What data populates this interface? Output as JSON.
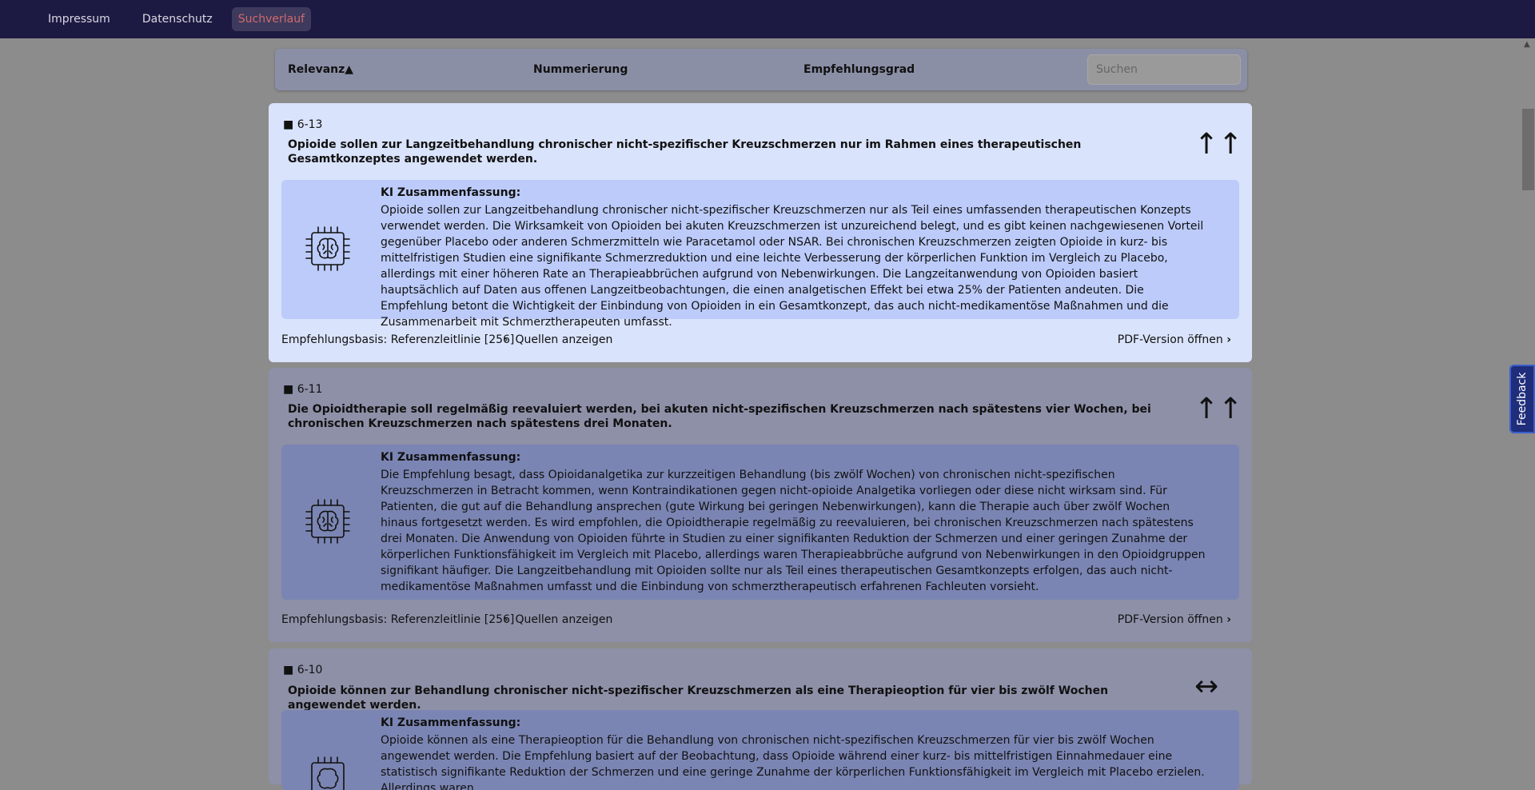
{
  "nav": {
    "links": [
      "Impressum",
      "Datenschutz",
      "Suchverlauf"
    ],
    "active_link": "Suchverlauf"
  },
  "filterbar": {
    "relevance": "Relevanz▲",
    "numbering": "Nummerierung",
    "grade": "Empfehlungsgrad",
    "search_placeholder": "Suchen"
  },
  "summary_label": "KI Zusammenfassung:",
  "footer": {
    "basis": "Empfehlungsbasis: Referenzleitlinie [256]",
    "sources": "Quellen anzeigen",
    "pdf": "PDF-Version öffnen"
  },
  "cards": [
    {
      "number": "6-13",
      "title": "Opioide sollen zur Langzeitbehandlung chronischer nicht-spezifischer Kreuzschmerzen nur im Rahmen eines therapeutischen Gesamtkonzeptes angewendet werden.",
      "grade_symbol": "↑↑",
      "summary": "Opioide sollen zur Langzeitbehandlung chronischer nicht-spezifischer Kreuzschmerzen nur als Teil eines umfassenden therapeutischen Konzepts verwendet werden. Die Wirksamkeit von Opioiden bei akuten Kreuzschmerzen ist unzureichend belegt, und es gibt keinen nachgewiesenen Vorteil gegenüber Placebo oder anderen Schmerzmitteln wie Paracetamol oder NSAR. Bei chronischen Kreuzschmerzen zeigten Opioide in kurz- bis mittelfristigen Studien eine signifikante Schmerzreduktion und eine leichte Verbesserung der körperlichen Funktion im Vergleich zu Placebo, allerdings mit einer höheren Rate an Therapieabbrüchen aufgrund von Nebenwirkungen. Die Langzeitanwendung von Opioiden basiert hauptsächlich auf Daten aus offenen Langzeitbeobachtungen, die einen analgetischen Effekt bei etwa 25% der Patienten andeuten. Die Empfehlung betont die Wichtigkeit der Einbindung von Opioiden in ein Gesamtkonzept, das auch nicht-medikamentöse Maßnahmen und die Zusammenarbeit mit Schmerztherapeuten umfasst."
    },
    {
      "number": "6-11",
      "title": "Die Opioidtherapie soll regelmäßig reevaluiert werden, bei akuten nicht-spezifischen Kreuzschmerzen nach spätestens vier Wochen, bei chronischen Kreuzschmerzen nach spätestens drei Monaten.",
      "grade_symbol": "↑↑",
      "summary": "Die Empfehlung besagt, dass Opioidanalgetika zur kurzzeitigen Behandlung (bis zwölf Wochen) von chronischen nicht-spezifischen Kreuzschmerzen in Betracht kommen, wenn Kontraindikationen gegen nicht-opioide Analgetika vorliegen oder diese nicht wirksam sind. Für Patienten, die gut auf die Behandlung ansprechen (gute Wirkung bei geringen Nebenwirkungen), kann die Therapie auch über zwölf Wochen hinaus fortgesetzt werden. Es wird empfohlen, die Opioidtherapie regelmäßig zu reevaluieren, bei chronischen Kreuzschmerzen nach spätestens drei Monaten. Die Anwendung von Opioiden führte in Studien zu einer signifikanten Reduktion der Schmerzen und einer geringen Zunahme der körperlichen Funktionsfähigkeit im Vergleich mit Placebo, allerdings waren Therapieabbrüche aufgrund von Nebenwirkungen in den Opioidgruppen signifikant häufiger. Die Langzeitbehandlung mit Opioiden sollte nur als Teil eines therapeutischen Gesamtkonzepts erfolgen, das auch nicht-medikamentöse Maßnahmen umfasst und die Einbindung von schmerztherapeutisch erfahrenen Fachleuten vorsieht."
    },
    {
      "number": "6-10",
      "title": "Opioide können zur Behandlung chronischer nicht-spezifischer Kreuzschmerzen als eine Therapieoption für vier bis zwölf Wochen angewendet werden.",
      "grade_symbol": "↔",
      "summary": "Opioide können als eine Therapieoption für die Behandlung von chronischen nicht-spezifischen Kreuzschmerzen für vier bis zwölf Wochen angewendet werden. Die Empfehlung basiert auf der Beobachtung, dass Opioide während einer kurz- bis mittelfristigen Einnahmedauer eine statistisch signifikante Reduktion der Schmerzen und eine geringe Zunahme der körperlichen Funktionsfähigkeit im Vergleich mit Placebo erzielen. Allerdings waren"
    }
  ],
  "feedback_label": "Feedback"
}
